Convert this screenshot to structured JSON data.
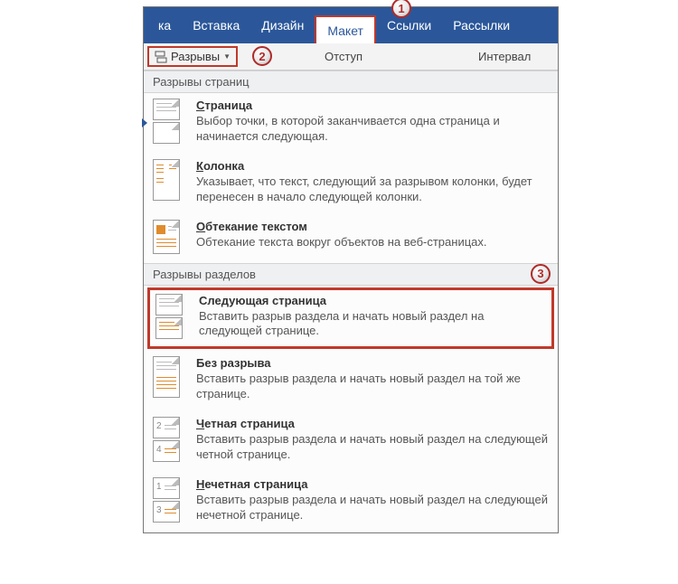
{
  "ribbon": {
    "tab_partial": "ка",
    "tabs": [
      "Вставка",
      "Дизайн",
      "Макет",
      "Ссылки",
      "Рассылки"
    ],
    "active_index": 2
  },
  "toolbar": {
    "breaks_label": "Разрывы",
    "indent_label": "Отступ",
    "spacing_label": "Интервал"
  },
  "callouts": {
    "c1": "1",
    "c2": "2",
    "c3": "3"
  },
  "groups": {
    "pagebreaks_header": "Разрывы страниц",
    "sectionbreaks_header": "Разрывы разделов"
  },
  "items": {
    "page": {
      "title_ul": "С",
      "title_rest": "траница",
      "desc": "Выбор точки, в которой заканчивается одна страница и начинается следующая."
    },
    "column": {
      "title_ul": "К",
      "title_rest": "олонка",
      "desc": "Указывает, что текст, следующий за разрывом колонки, будет перенесен в начало следующей колонки."
    },
    "wrap": {
      "title_ul": "О",
      "title_rest": "бтекание текстом",
      "desc": "Обтекание текста вокруг объектов на веб-страницах."
    },
    "nextpage": {
      "title": "Следующая страница",
      "desc": "Вставить разрыв раздела и начать новый раздел на следующей странице."
    },
    "continuous": {
      "title": "Без разрыва",
      "desc": "Вставить разрыв раздела и начать новый раздел на той же странице."
    },
    "even": {
      "title_ul": "Ч",
      "title_rest": "етная страница",
      "num_a": "2",
      "num_b": "4",
      "desc": "Вставить разрыв раздела и начать новый раздел на следующей четной странице."
    },
    "odd": {
      "title_ul": "Н",
      "title_rest": "ечетная страница",
      "num_a": "1",
      "num_b": "3",
      "desc": "Вставить разрыв раздела и начать новый раздел на следующей нечетной странице."
    }
  }
}
